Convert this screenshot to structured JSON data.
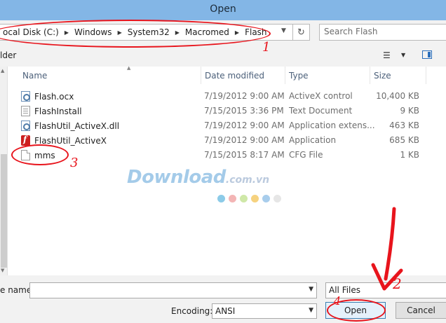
{
  "window": {
    "title": "Open"
  },
  "address": {
    "crumbs": [
      "ocal Disk (C:)",
      "Windows",
      "System32",
      "Macromed",
      "Flash"
    ]
  },
  "search": {
    "placeholder": "Search Flash"
  },
  "toolbar": {
    "new_folder_label": "lder"
  },
  "columns": {
    "name": "Name",
    "date": "Date modified",
    "type": "Type",
    "size": "Size"
  },
  "files": [
    {
      "icon": "activex-file-icon",
      "name": "Flash.ocx",
      "date": "7/19/2012 9:00 AM",
      "type": "ActiveX control",
      "size": "10,400 KB"
    },
    {
      "icon": "text-document-icon",
      "name": "FlashInstall",
      "date": "7/15/2015 3:36 PM",
      "type": "Text Document",
      "size": "9 KB"
    },
    {
      "icon": "dll-file-icon",
      "name": "FlashUtil_ActiveX.dll",
      "date": "7/19/2012 9:00 AM",
      "type": "Application extens...",
      "size": "463 KB"
    },
    {
      "icon": "flash-application-icon",
      "name": "FlashUtil_ActiveX",
      "date": "7/19/2012 9:00 AM",
      "type": "Application",
      "size": "685 KB"
    },
    {
      "icon": "cfg-file-icon",
      "name": "mms",
      "date": "7/15/2015 8:17 AM",
      "type": "CFG File",
      "size": "1 KB"
    }
  ],
  "watermark": {
    "brand": "Download",
    "suffix": ".com.vn"
  },
  "filename": {
    "label": "e name:",
    "value": ""
  },
  "filter": {
    "selected": "All Files"
  },
  "encoding": {
    "label": "Encoding:",
    "selected": "ANSI"
  },
  "buttons": {
    "open": "Open",
    "cancel": "Cancel"
  },
  "annotations": {
    "step1": "1",
    "step2": "2",
    "step3": "3",
    "step4": "4"
  },
  "colors": {
    "accent_red": "#e8141c",
    "titlebar": "#83b6e6",
    "header_text": "#4c607a",
    "watermark_dots": [
      "#8ccbe8",
      "#f3b5b5",
      "#cfe8a8",
      "#f6d27f",
      "#a8cdec",
      "#e6e6e6"
    ]
  }
}
